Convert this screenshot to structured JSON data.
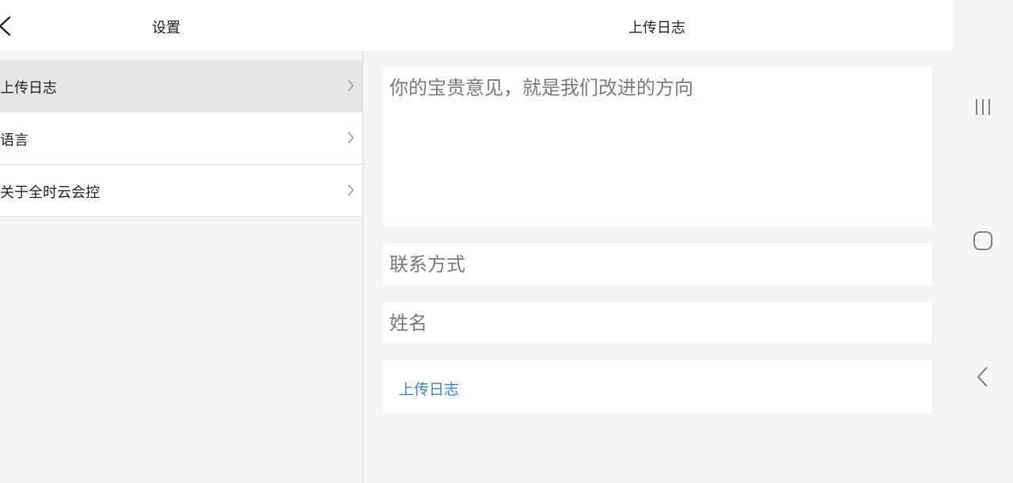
{
  "header": {
    "settings_title": "设置",
    "page_title": "上传日志"
  },
  "sidebar": {
    "items": [
      {
        "label": "上传日志",
        "active": true
      },
      {
        "label": "语言",
        "active": false
      },
      {
        "label": "关于全时云会控",
        "active": false
      }
    ]
  },
  "form": {
    "feedback_placeholder": "你的宝贵意见，就是我们改进的方向",
    "contact_placeholder": "联系方式",
    "name_placeholder": "姓名",
    "submit_label": "上传日志"
  },
  "colors": {
    "accent": "#3a86c8",
    "background": "#f4f4f4",
    "active_item": "#e6e6e6"
  },
  "icons": {
    "back": "chevron-left-icon",
    "item_arrow": "chevron-right-icon",
    "nav_recent": "recent-apps-icon",
    "nav_home": "home-icon",
    "nav_back": "back-icon"
  }
}
